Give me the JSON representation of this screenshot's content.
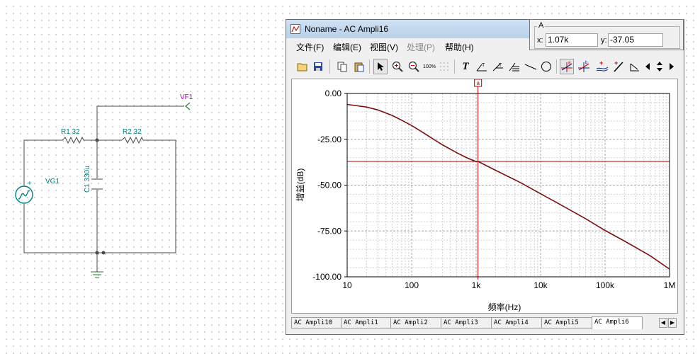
{
  "schematic": {
    "components": {
      "r1": "R1 32",
      "r2": "R2 32",
      "c1": "C1 330u",
      "source": "VG1",
      "probe": "VF1"
    },
    "wire_color": "#4a4a4a",
    "label_color": "#008080",
    "probe_color": "#b000b0"
  },
  "window": {
    "title": "Noname - AC Ampli16",
    "menu": [
      {
        "label": "文件(F)",
        "enabled": true
      },
      {
        "label": "编辑(E)",
        "enabled": true
      },
      {
        "label": "视图(V)",
        "enabled": true
      },
      {
        "label": "处理(P)",
        "enabled": false
      },
      {
        "label": "帮助(H)",
        "enabled": true
      }
    ],
    "toolbar_icons": [
      "open-icon",
      "save-icon",
      "copy-icon",
      "paste-icon",
      "pointer-icon",
      "zoom-in-icon",
      "zoom-out-icon",
      "zoom-100-icon",
      "grid-icon",
      "text-icon",
      "arrow-label-icon",
      "arrow-label2-icon",
      "multi-label-icon",
      "line-icon",
      "circle-icon",
      "cursor-a-icon",
      "cursor-b-icon",
      "add-curve-icon",
      "probe-icon",
      "step-icon",
      "prev-icon",
      "updown-icon",
      "next-icon"
    ]
  },
  "readout": {
    "group_label": "A",
    "x_label": "x:",
    "x_value": "1.07k",
    "y_label": "y:",
    "y_value": "-37.05"
  },
  "chart_data": {
    "type": "line",
    "title": "",
    "xlabel": "频率(Hz)",
    "ylabel": "增益(dB)",
    "x_scale": "log",
    "xlim": [
      10,
      1000000
    ],
    "ylim": [
      -100,
      0
    ],
    "x_ticks": [
      "10",
      "100",
      "1k",
      "10k",
      "100k",
      "1M"
    ],
    "y_ticks": [
      "0.00",
      "-25.00",
      "-50.00",
      "-75.00",
      "-100.00"
    ],
    "grid": true,
    "cursor": {
      "label": "a",
      "x": 1070,
      "y": -37.05
    },
    "series": [
      {
        "color": "#7b1010",
        "points": [
          [
            10,
            -6.0
          ],
          [
            20,
            -7.4
          ],
          [
            30,
            -9.0
          ],
          [
            50,
            -12.0
          ],
          [
            70,
            -14.6
          ],
          [
            100,
            -17.5
          ],
          [
            150,
            -21.3
          ],
          [
            200,
            -24.1
          ],
          [
            300,
            -28.0
          ],
          [
            500,
            -32.3
          ],
          [
            700,
            -34.9
          ],
          [
            1000,
            -37.2
          ],
          [
            1070,
            -37.05
          ],
          [
            2000,
            -41.9
          ],
          [
            5000,
            -48.8
          ],
          [
            10000,
            -54.7
          ],
          [
            20000,
            -60.5
          ],
          [
            50000,
            -68.3
          ],
          [
            100000,
            -74.7
          ],
          [
            200000,
            -80.5
          ],
          [
            500000,
            -88.5
          ],
          [
            1000000,
            -95.8
          ]
        ]
      }
    ]
  },
  "tabs": [
    "AC Ampli10",
    "AC Ampli1",
    "AC Ampli2",
    "AC Ampli3",
    "AC Ampli4",
    "AC Ampli5",
    "AC Ampli6"
  ],
  "active_tab": 6
}
